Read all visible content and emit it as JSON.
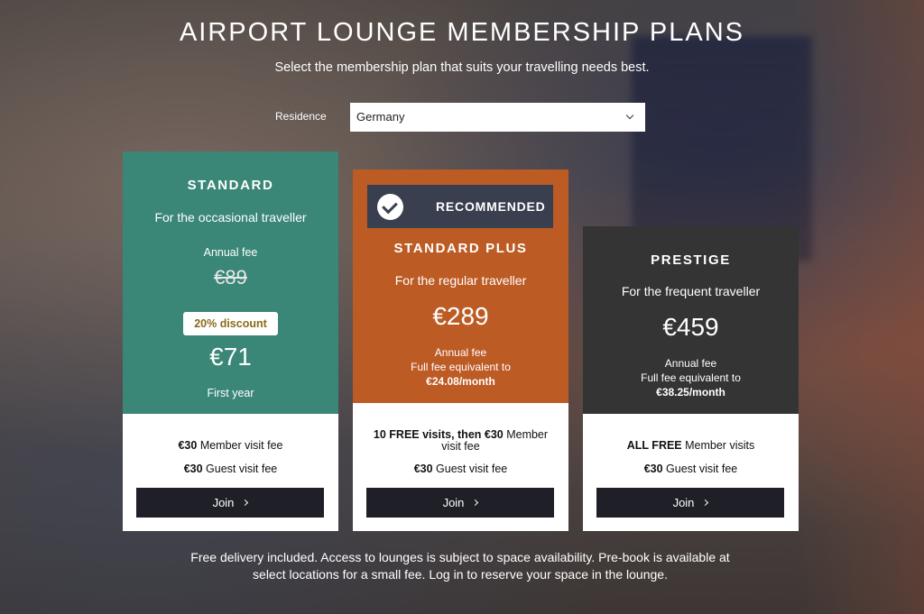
{
  "page": {
    "title": "AIRPORT LOUNGE MEMBERSHIP PLANS",
    "subtitle": "Select the membership plan that suits your travelling needs best."
  },
  "residence": {
    "label": "Residence",
    "selected": "Germany"
  },
  "plans": [
    {
      "name": "STANDARD",
      "tagline": "For the occasional traveller",
      "fee_label": "Annual fee",
      "original_price": "€89",
      "discount": "20% discount",
      "price": "€71",
      "price_note": "First year",
      "member_visit_bold": "€30",
      "member_visit_text": " Member visit fee",
      "guest_visit_bold": "€30",
      "guest_visit_text": " Guest visit fee",
      "join_label": "Join",
      "color": "#3a8677"
    },
    {
      "badge": "RECOMMENDED",
      "name": "STANDARD PLUS",
      "tagline": "For the regular traveller",
      "price": "€289",
      "fee_label": "Annual fee",
      "equiv_label": "Full fee equivalent to",
      "equiv_value": "€24.08/month",
      "member_visit_bold": "10 FREE visits, then €30",
      "member_visit_text": " Member visit fee",
      "guest_visit_bold": "€30",
      "guest_visit_text": " Guest visit fee",
      "join_label": "Join",
      "color": "#bd5b25"
    },
    {
      "name": "PRESTIGE",
      "tagline": "For the frequent traveller",
      "price": "€459",
      "fee_label": "Annual fee",
      "equiv_label": "Full fee equivalent to",
      "equiv_value": "€38.25/month",
      "member_visit_bold": "ALL FREE",
      "member_visit_text": " Member visits",
      "guest_visit_bold": "€30",
      "guest_visit_text": " Guest visit fee",
      "join_label": "Join",
      "color": "#333433"
    }
  ],
  "footer": {
    "line1": "Free delivery included. Access to lounges is subject to space availability. Pre-book is available at",
    "line2": "select locations for a small fee. Log in to reserve your space in the lounge."
  },
  "icons": {
    "check": "check-circle-icon",
    "chevron": "chevron-down-icon",
    "arrow": "chevron-right-icon"
  }
}
